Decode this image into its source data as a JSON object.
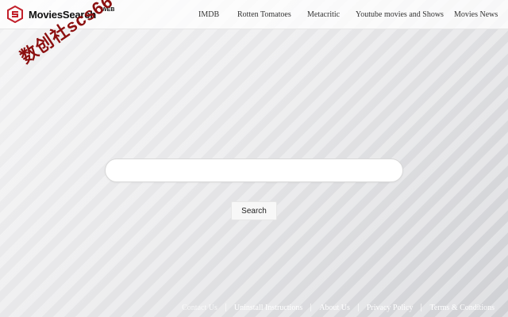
{
  "header": {
    "logo_text": "MoviesSearch",
    "logo_sup": "WEB",
    "nav": [
      {
        "label": "IMDB"
      },
      {
        "label": "Rotten Tomatoes"
      },
      {
        "label": "Metacritic"
      },
      {
        "label": "Youtube movies and Shows"
      },
      {
        "label": "Movies News"
      }
    ]
  },
  "watermark": {
    "text": "数创社scs66"
  },
  "search": {
    "value": "",
    "placeholder": "",
    "button_label": "Search"
  },
  "footer": {
    "links": [
      {
        "label": "Contact Us"
      },
      {
        "label": "Uninstall Instructions"
      },
      {
        "label": "About Us"
      },
      {
        "label": "Privacy Policy"
      },
      {
        "label": "Terms & Conditions"
      }
    ]
  },
  "colors": {
    "brand_red": "#c21f2a",
    "text_dark": "#333333",
    "footer_text": "#ffffff",
    "watermark_red": "#8c1010"
  },
  "icons": {
    "logo": "hexagon-film-logo-icon"
  }
}
